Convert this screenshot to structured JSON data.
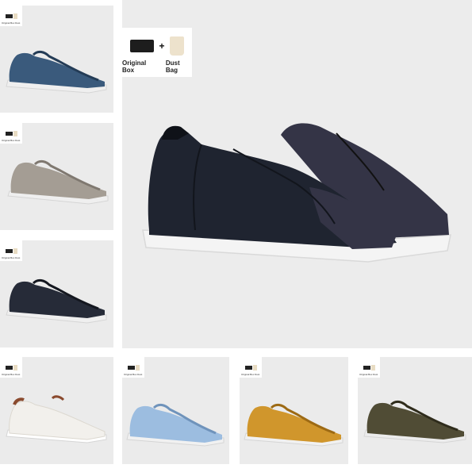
{
  "badge": {
    "box_label": "Original Box",
    "plus": "+",
    "bag_label": "Dust Bag",
    "mini_caption": "Original Box  Dust Bag"
  },
  "main_image": {
    "colorway": "navy-leather-suede",
    "upper": "#1f2430",
    "suede": "#343446",
    "sole": "#f4f4f4"
  },
  "thumbnails": [
    {
      "colorway": "blue-suede",
      "upper": "#2f4f6f",
      "suede": "#3a5a7c",
      "sole": "#efefef"
    },
    {
      "colorway": "taupe-suede",
      "upper": "#9a938b",
      "suede": "#a49d94",
      "sole": "#efefef"
    },
    {
      "colorway": "navy-leather",
      "upper": "#1e2330",
      "suede": "#262b38",
      "sole": "#efefef"
    },
    {
      "colorway": "white-leather",
      "upper": "#f2f0ec",
      "suede": "#e9e5de",
      "sole": "#ffffff",
      "accent": "#8a4a2e"
    },
    {
      "colorway": "light-blue-suede",
      "upper": "#8fb3d8",
      "suede": "#9cbde0",
      "sole": "#f1f1f1"
    },
    {
      "colorway": "mustard-suede",
      "upper": "#c98a1f",
      "suede": "#d0962c",
      "sole": "#f1f1f1"
    },
    {
      "colorway": "olive-suede",
      "upper": "#46432e",
      "suede": "#504c35",
      "sole": "#ececec"
    }
  ]
}
